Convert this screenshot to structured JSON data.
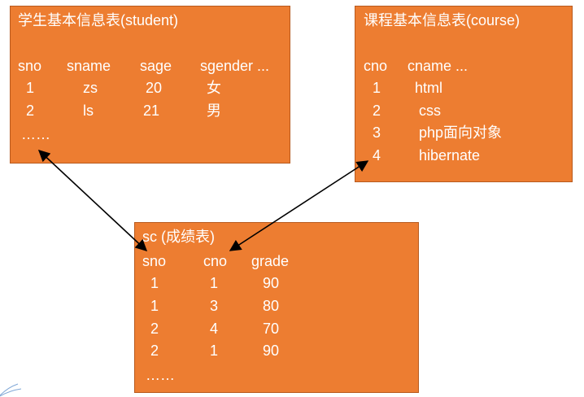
{
  "colors": {
    "box_fill": "#ED7D31",
    "box_text": "#FFFFFF",
    "arrow": "#000000"
  },
  "student": {
    "title": "学生基本信息表(student)",
    "headers": [
      "sno",
      "sname",
      "sage",
      "sgender ..."
    ],
    "rows": [
      [
        "1",
        "zs",
        "20",
        "女"
      ],
      [
        "2",
        "ls",
        "21",
        "男"
      ]
    ],
    "ellipsis": "……"
  },
  "course": {
    "title": "课程基本信息表(course)",
    "headers": [
      "cno",
      "cname ..."
    ],
    "rows": [
      [
        "1",
        "html"
      ],
      [
        "2",
        "css"
      ],
      [
        "3",
        "php面向对象"
      ],
      [
        "4",
        "hibernate"
      ]
    ]
  },
  "sc": {
    "title": "sc (成绩表)",
    "headers": [
      "sno",
      "cno",
      "grade"
    ],
    "rows": [
      [
        "1",
        "1",
        "90"
      ],
      [
        "1",
        "3",
        "80"
      ],
      [
        "2",
        "4",
        "70"
      ],
      [
        "2",
        "1",
        "90"
      ]
    ],
    "ellipsis": "……"
  }
}
